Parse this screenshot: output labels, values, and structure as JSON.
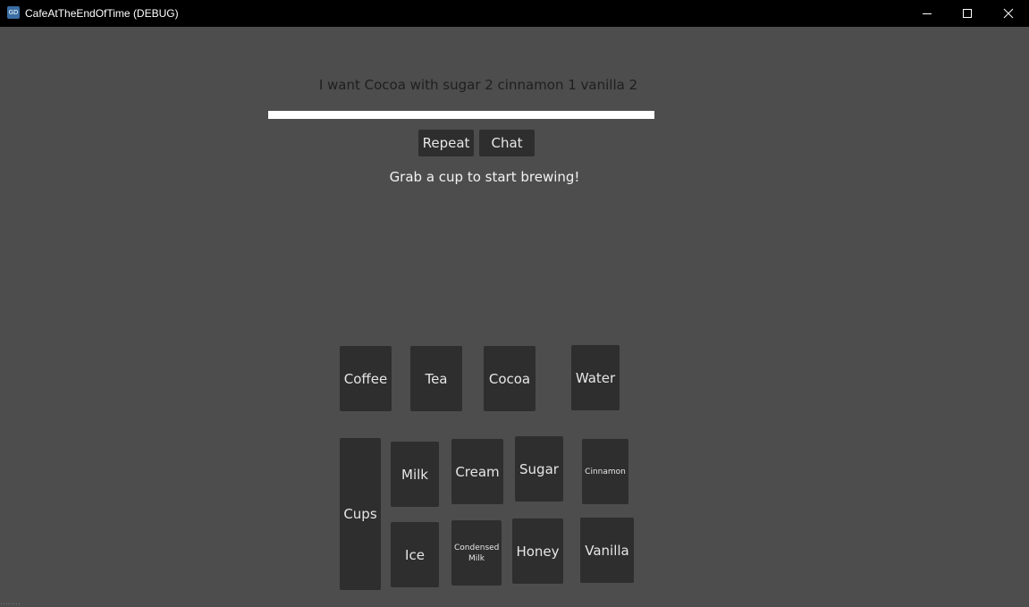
{
  "window": {
    "title": "CafeAtTheEndOfTime (DEBUG)",
    "app_icon_text": "GD"
  },
  "customer": {
    "request": "I want Cocoa with sugar 2 cinnamon 1 vanilla 2",
    "patience_fraction": 1.0
  },
  "buttons": {
    "repeat": "Repeat",
    "chat": "Chat"
  },
  "hint": "Grab a cup to start brewing!",
  "bases": {
    "coffee": "Coffee",
    "tea": "Tea",
    "cocoa": "Cocoa",
    "water": "Water"
  },
  "cups": "Cups",
  "addins": {
    "milk": "Milk",
    "cream": "Cream",
    "sugar": "Sugar",
    "cinnamon": "Cinnamon",
    "ice": "Ice",
    "condensed_milk": "Condensed Milk",
    "honey": "Honey",
    "vanilla": "Vanilla"
  },
  "status_text": "........"
}
